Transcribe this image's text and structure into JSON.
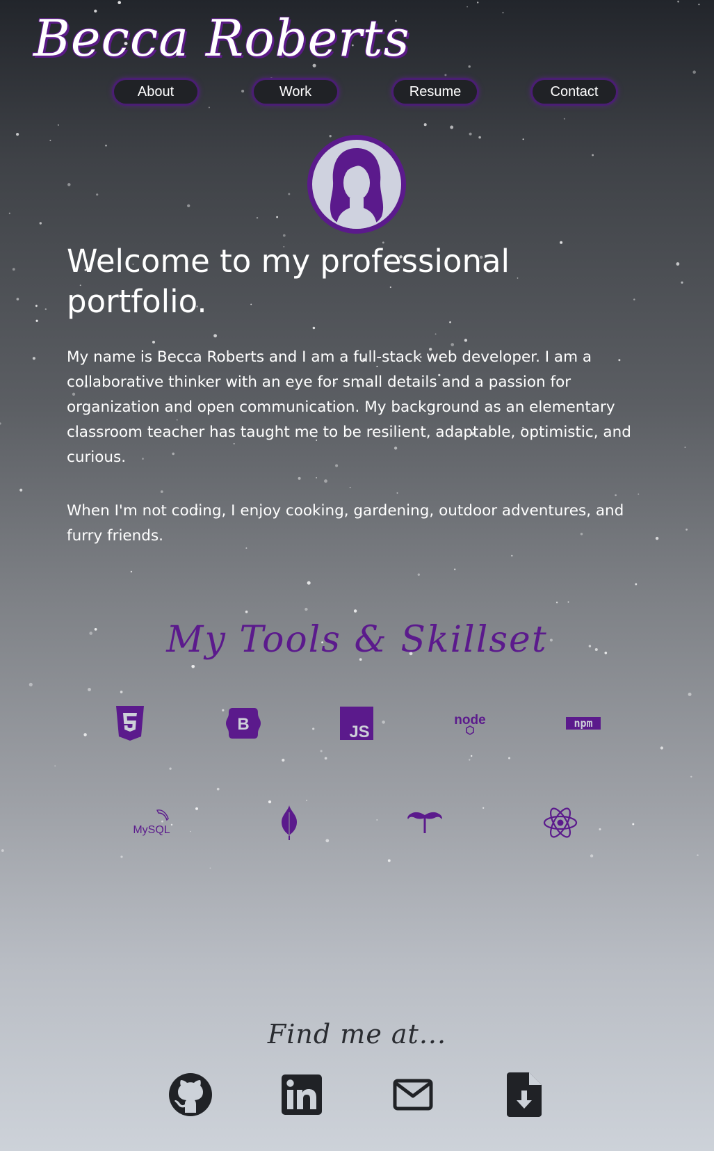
{
  "header": {
    "name": "Becca Roberts"
  },
  "nav": [
    {
      "label": "About"
    },
    {
      "label": "Work"
    },
    {
      "label": "Resume"
    },
    {
      "label": "Contact"
    }
  ],
  "about": {
    "heading": "Welcome to my professional portfolio.",
    "paragraph1": "My name is Becca Roberts and I am a full-stack web developer. I am a collaborative thinker with an eye for small details and a passion for organization and open communication. My background as an elementary classroom teacher has taught me to be resilient, adaptable, optimistic, and curious.",
    "paragraph2": "When I'm not coding, I enjoy cooking, gardening, outdoor adventures, and furry friends."
  },
  "skills": {
    "title": "My Tools & Skillset",
    "icons": [
      "html5-icon",
      "bootstrap-icon",
      "javascript-icon",
      "nodejs-icon",
      "npm-icon",
      "mysql-icon",
      "mongodb-icon",
      "handlebars-icon",
      "react-icon"
    ],
    "js_text": "JS",
    "bootstrap_text": "B",
    "node_text": "node",
    "npm_text": "npm",
    "mysql_text": "MySQL"
  },
  "find": {
    "title": "Find me at...",
    "links": [
      "github-icon",
      "linkedin-icon",
      "email-icon",
      "resume-download-icon"
    ]
  },
  "colors": {
    "accent": "#5b1a8c",
    "dark": "#202226"
  }
}
